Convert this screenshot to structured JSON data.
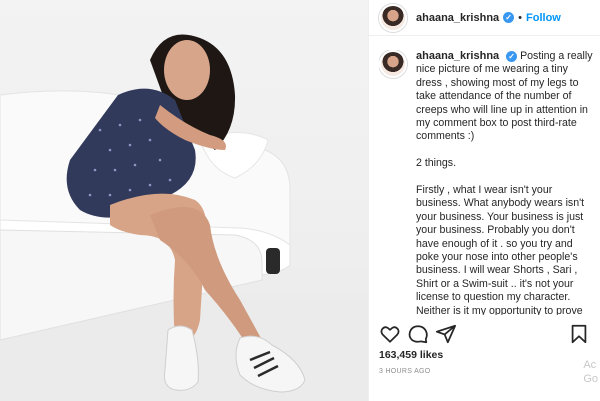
{
  "post": {
    "username": "ahaana_krishna",
    "verified_mark": "✓",
    "separator": "•",
    "follow_label": "Follow",
    "caption_paragraphs": [
      "Posting a really nice picture of me wearing a tiny dress , showing most of my legs to take attendance of the number of creeps who will line up in attention in my comment box to post third-rate comments :)",
      "2 things.",
      "Firstly , what I wear isn't your business. What anybody wears isn't your business. Your business is just your business. Probably you don't have enough of it . so you try and poke your nose into other people's business. I will wear Shorts , Sari , Shirt or a Swim-suit .. it's not your license to question my character. Neither is it my opportunity to prove my own"
    ],
    "likes": "163,459 likes",
    "timestamp": "3 HOURS AGO"
  },
  "icons": {
    "like": "heart-icon",
    "comment": "comment-icon",
    "share": "share-icon",
    "save": "bookmark-icon"
  },
  "watermark": {
    "line1": "Ac",
    "line2": "Go"
  },
  "colors": {
    "accent": "#0095f6",
    "verified": "#3897f0",
    "text": "#262626",
    "muted": "#8e8e8e"
  }
}
